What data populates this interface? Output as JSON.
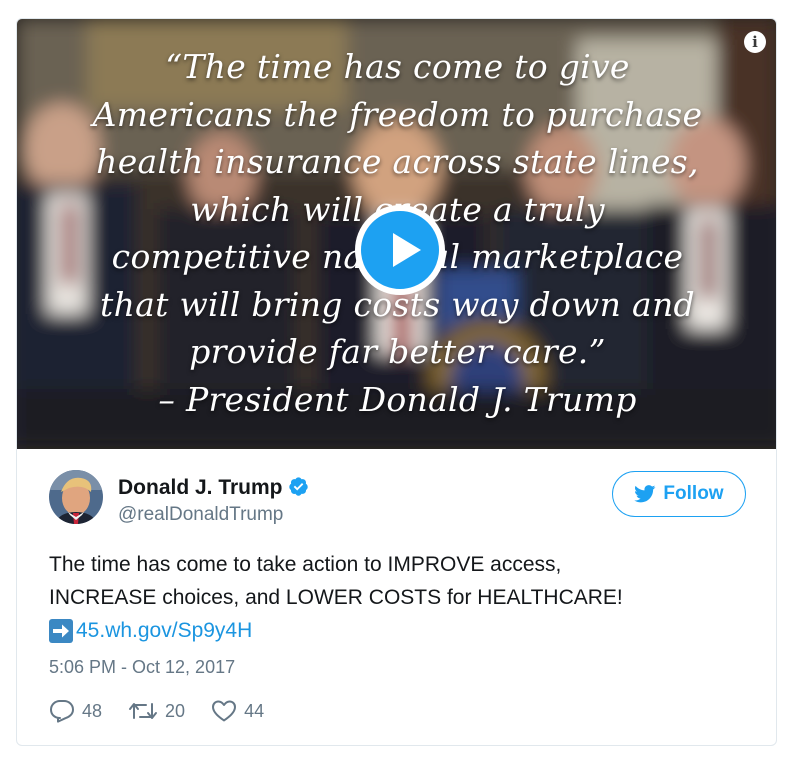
{
  "media": {
    "quote_lines": [
      "“The time has come to give",
      "Americans the freedom to purchase",
      "health insurance across state lines,",
      "which will create a truly",
      "competitive national marketplace",
      "that will bring costs way down and",
      "provide far better care.”"
    ],
    "attribution": "– President Donald J. Trump",
    "info_glyph": "i",
    "play_icon": "play-icon"
  },
  "user": {
    "name": "Donald J. Trump",
    "handle": "@realDonaldTrump",
    "verified": true,
    "avatar_icon": "avatar"
  },
  "follow": {
    "label": "Follow",
    "icon": "twitter-bird-icon"
  },
  "tweet": {
    "line1": "The time has come to take action to IMPROVE access,",
    "line2": "INCREASE choices, and LOWER COSTS for HEALTHCARE!",
    "link": "45.wh.gov/Sp9y4H",
    "link_emoji": "right-arrow-emoji",
    "timestamp": "5:06 PM - Oct 12, 2017"
  },
  "stats": {
    "replies": "48",
    "retweets": "20",
    "likes": "44"
  },
  "colors": {
    "accent": "#1da1f2",
    "link": "#1b95e0",
    "muted": "#657786",
    "text": "#14171a",
    "border": "#e1e8ed"
  }
}
